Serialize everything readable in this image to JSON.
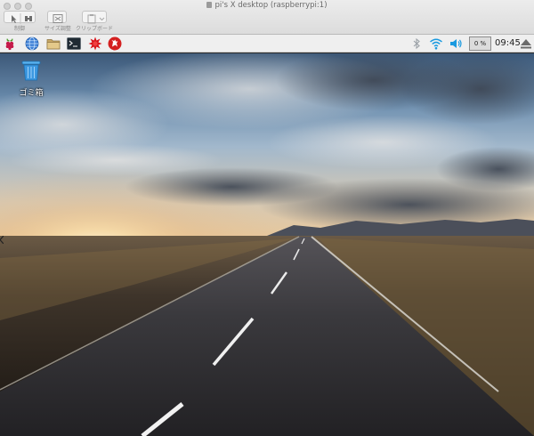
{
  "window": {
    "title": "pi's X desktop (raspberrypi:1)"
  },
  "toolbar": {
    "control_label": "制御",
    "resize_label": "サイズ調整",
    "clipboard_label": "クリップボード"
  },
  "panel": {
    "icons": [
      "raspberry-menu-icon",
      "web-browser-icon",
      "file-manager-icon",
      "terminal-icon",
      "math-star-icon",
      "wolfram-icon"
    ],
    "tray_icons": [
      "bluetooth-icon",
      "wifi-icon",
      "volume-icon",
      "eject-icon"
    ],
    "cpu": "0 %",
    "clock": "09:45"
  },
  "desktop": {
    "trash_label": "ゴミ箱",
    "wallpaper": "sunset road with cloudy sky"
  },
  "colors": {
    "panel_bg": "#efefef",
    "wifi": "#1a9ae0",
    "raspberry": "#c51a4a"
  }
}
